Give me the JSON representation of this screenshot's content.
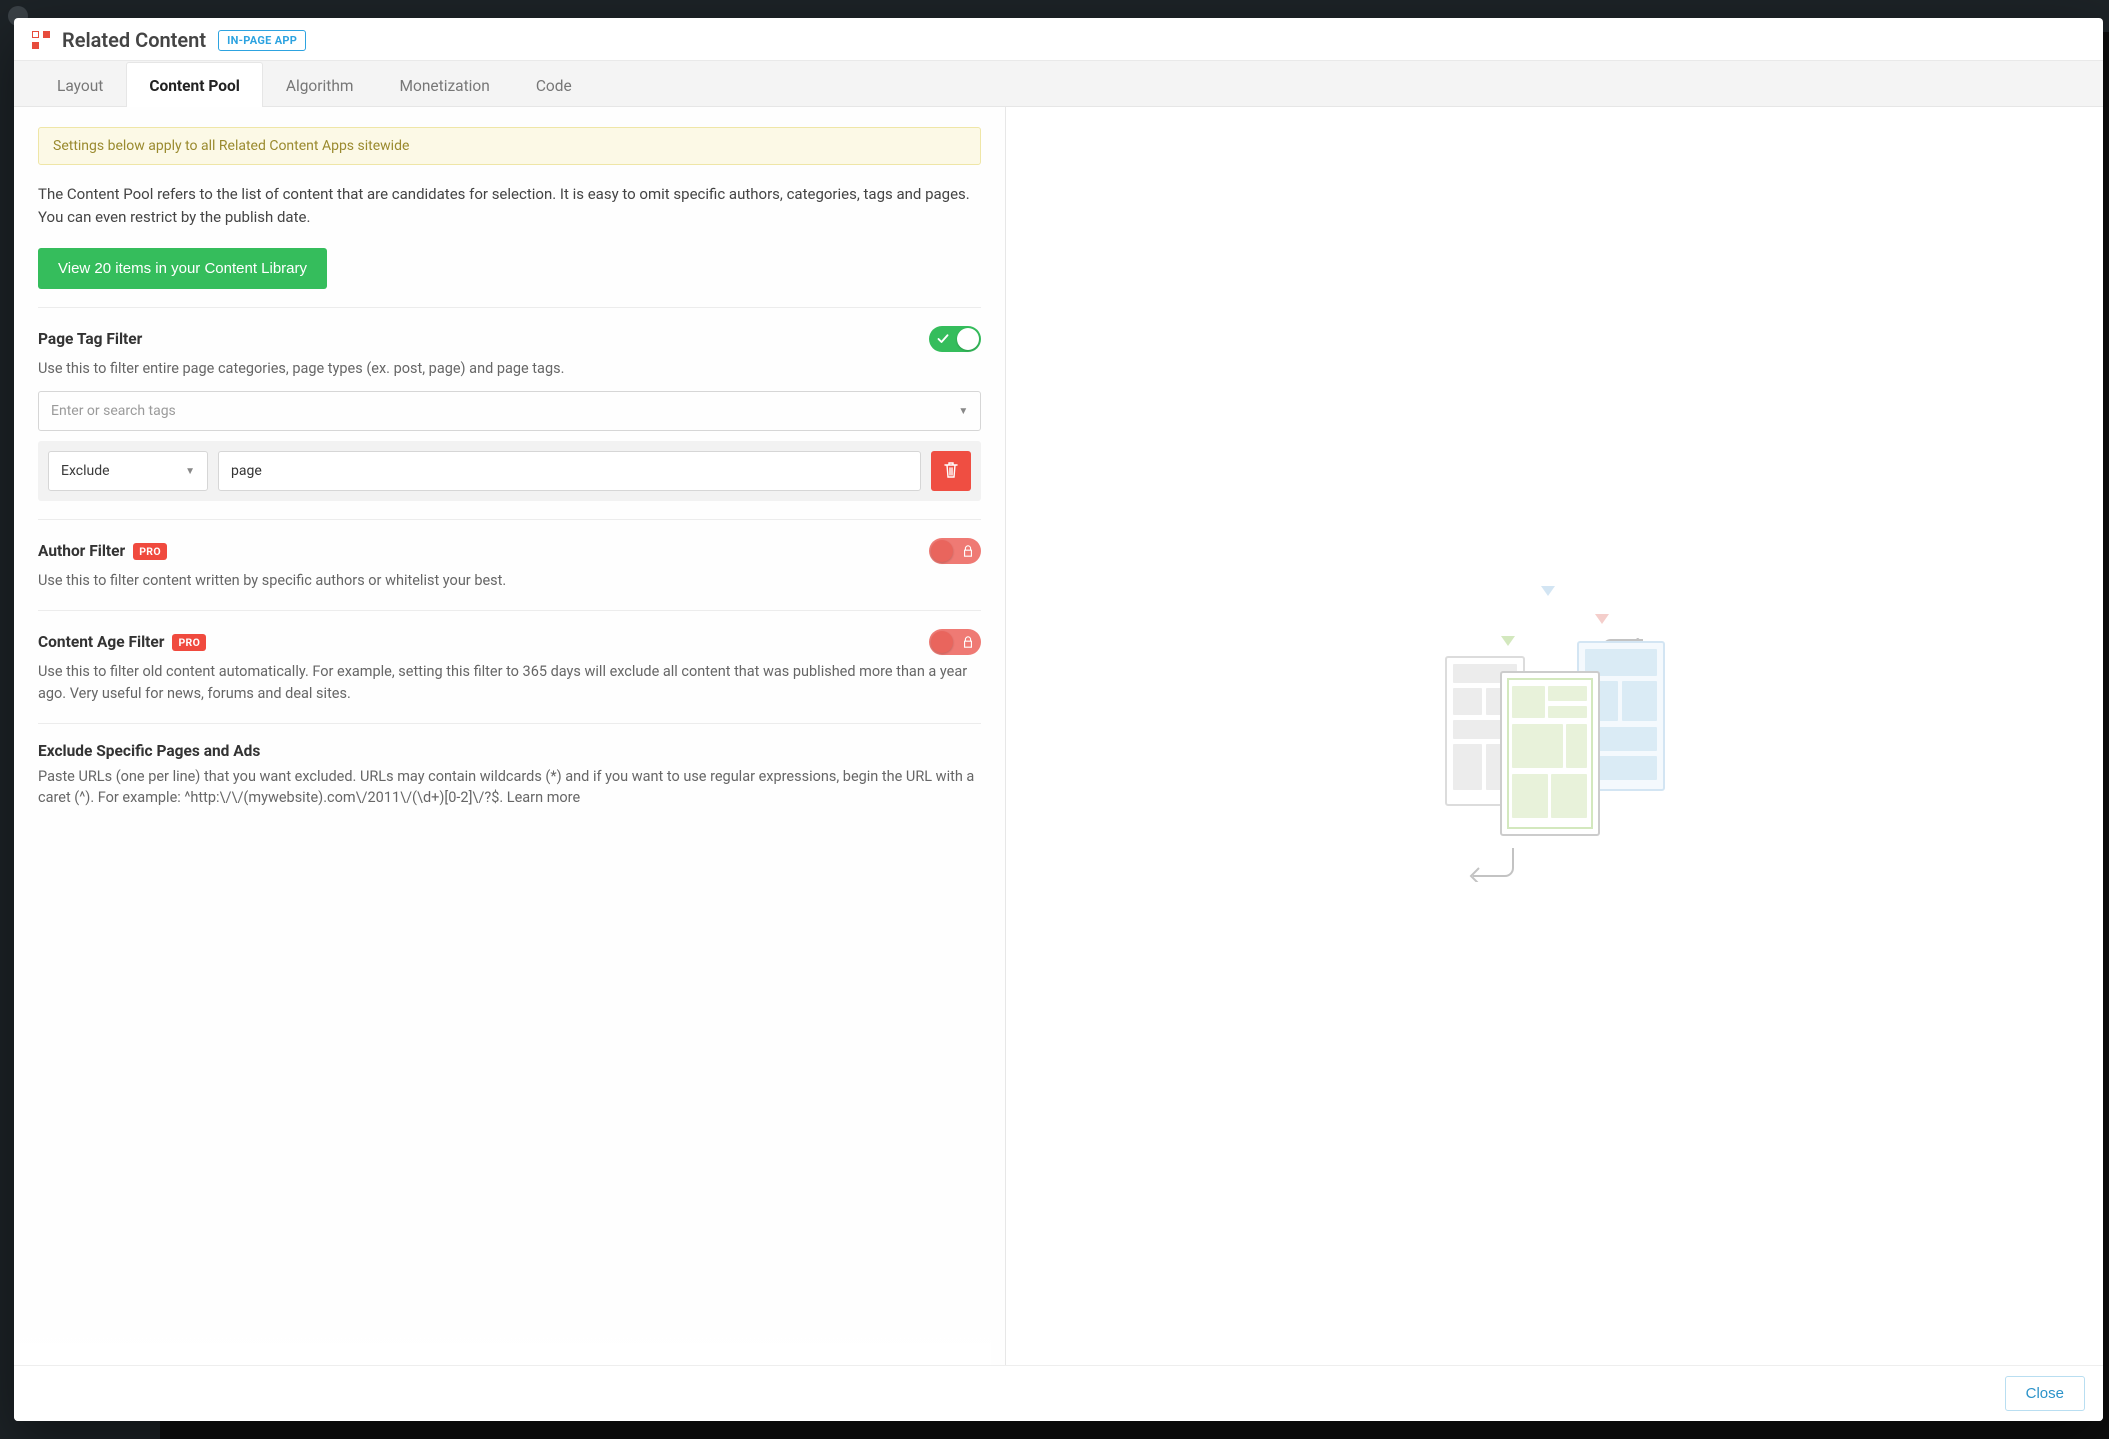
{
  "header": {
    "title": "Related Content",
    "badge": "IN-PAGE APP"
  },
  "tabs": [
    {
      "label": "Layout",
      "active": false
    },
    {
      "label": "Content Pool",
      "active": true
    },
    {
      "label": "Algorithm",
      "active": false
    },
    {
      "label": "Monetization",
      "active": false
    },
    {
      "label": "Code",
      "active": false
    }
  ],
  "notice": "Settings below apply to all Related Content Apps sitewide",
  "intro": "The Content Pool refers to the list of content that are candidates for selection. It is easy to omit specific authors, categories, tags and pages. You can even restrict by the publish date.",
  "view_library_button": "View 20 items in your Content Library",
  "sections": {
    "page_tag_filter": {
      "title": "Page Tag Filter",
      "desc": "Use this to filter entire page categories, page types (ex. post, page) and page tags.",
      "toggle_on": true,
      "search_placeholder": "Enter or search tags",
      "rule_mode": "Exclude",
      "rule_value": "page"
    },
    "author_filter": {
      "title": "Author Filter",
      "pro": "PRO",
      "desc": "Use this to filter content written by specific authors or whitelist your best."
    },
    "content_age_filter": {
      "title": "Content Age Filter",
      "pro": "PRO",
      "desc": "Use this to filter old content automatically. For example, setting this filter to 365 days will exclude all content that was published more than a year ago. Very useful for news, forums and deal sites."
    },
    "exclude_pages": {
      "title": "Exclude Specific Pages and Ads",
      "desc": "Paste URLs (one per line) that you want excluded. URLs may contain wildcards (*) and if you want to use regular expressions, begin the URL with a caret (^). For example: ^http:\\/\\/(mywebsite).com\\/2011\\/(\\d+)[0-2]\\/?$. Learn more"
    }
  },
  "footer": {
    "close": "Close"
  }
}
